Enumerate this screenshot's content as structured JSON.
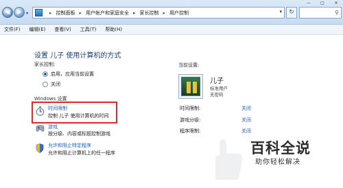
{
  "address": {
    "crumbs": [
      "控制面板",
      "用户帐户和家庭安全",
      "家长控制",
      "用户控制"
    ],
    "separator": "▸"
  },
  "window_controls": {
    "minimize": "—",
    "maximize": "□",
    "close": "✕"
  },
  "menu": [
    "文件(F)",
    "编辑(E)",
    "查看(V)",
    "工具(T)",
    "帮助(H)"
  ],
  "page": {
    "title": "设置 儿子 使用计算机的方式",
    "parental_control_label": "家长控制:",
    "radio_on": "启用，应用当前设置",
    "radio_off": "关闭",
    "windows_settings_label": "Windows 设置",
    "items": [
      {
        "title": "时间限制",
        "desc": "控制 儿子 使用计算机的时间"
      },
      {
        "title": "游戏",
        "desc": "按分级、内容或标题控制游戏"
      },
      {
        "title": "允许和阻止特定程序",
        "desc": "允许和阻止计算机上的任一程序"
      }
    ]
  },
  "current_settings": {
    "label": "当前设置:",
    "user_name": "儿子",
    "user_type": "标准用户",
    "password": "无密码",
    "rows": [
      {
        "label": "时间限制:",
        "value": "关闭"
      },
      {
        "label": "游戏分级:",
        "value": "关闭"
      },
      {
        "label": "程序限制:",
        "value": "关闭"
      }
    ]
  },
  "watermark": {
    "main": "百科全说",
    "sub": "助你轻松解决"
  },
  "colors": {
    "link": "#1f5fbf",
    "title": "#1c3f78",
    "highlight": "#e0262b"
  }
}
